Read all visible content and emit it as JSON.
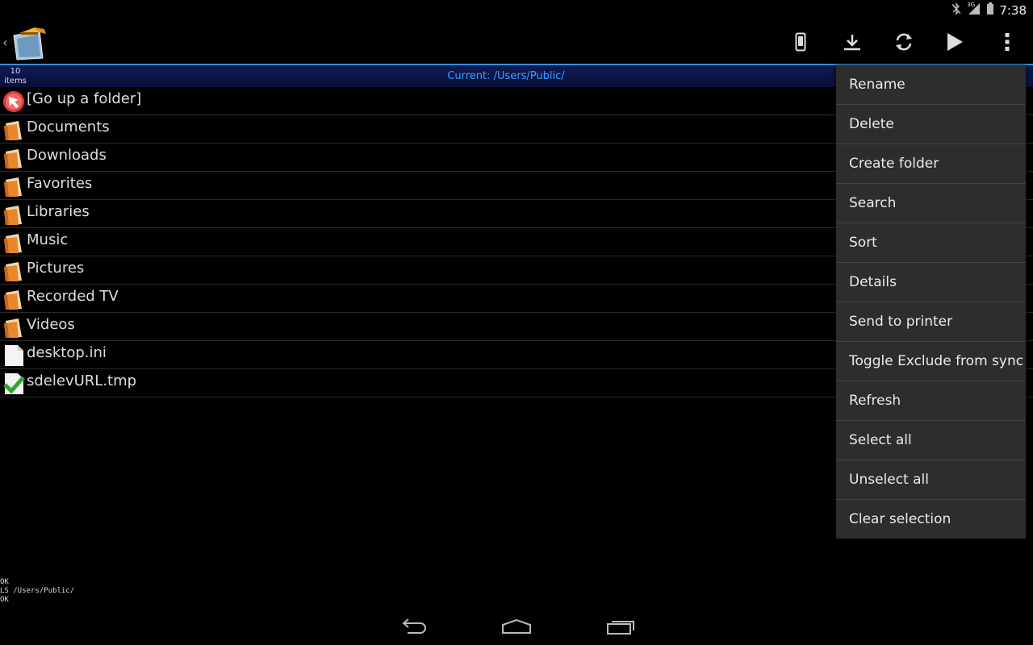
{
  "status_bar": {
    "time": "7:38",
    "network": "3G",
    "icons": [
      "bluetooth-off-icon",
      "signal-icon",
      "battery-icon"
    ]
  },
  "action_bar": {
    "actions": [
      "phone-icon",
      "download-icon",
      "refresh-icon",
      "play-icon",
      "overflow-menu-icon"
    ]
  },
  "path_bar": {
    "count": "10",
    "count_unit": "items",
    "current_path": "Current: /Users/Public/"
  },
  "files": [
    {
      "name": "[Go up a folder]",
      "icon": "go-up-icon"
    },
    {
      "name": "Documents",
      "icon": "folder-icon"
    },
    {
      "name": "Downloads",
      "icon": "folder-icon"
    },
    {
      "name": "Favorites",
      "icon": "folder-icon"
    },
    {
      "name": "Libraries",
      "icon": "folder-icon"
    },
    {
      "name": "Music",
      "icon": "folder-icon"
    },
    {
      "name": "Pictures",
      "icon": "folder-icon"
    },
    {
      "name": "Recorded TV",
      "icon": "folder-icon"
    },
    {
      "name": "Videos",
      "icon": "folder-icon"
    },
    {
      "name": "desktop.ini",
      "icon": "file-icon"
    },
    {
      "name": "sdelevURL.tmp",
      "icon": "checked-file-icon"
    }
  ],
  "console": {
    "line1": "OK",
    "line2": "LS /Users/Public/",
    "line3": "OK"
  },
  "menu": {
    "items": [
      "Rename",
      "Delete",
      "Create folder",
      "Search",
      "Sort",
      "Details",
      "Send to printer",
      "Toggle Exclude from sync",
      "Refresh",
      "Select all",
      "Unselect all",
      "Clear selection"
    ]
  },
  "colors": {
    "accent": "#3a8fd6",
    "path_text": "#3aa0ff",
    "menu_bg": "#2d2d2d",
    "folder": "#e8862a"
  }
}
